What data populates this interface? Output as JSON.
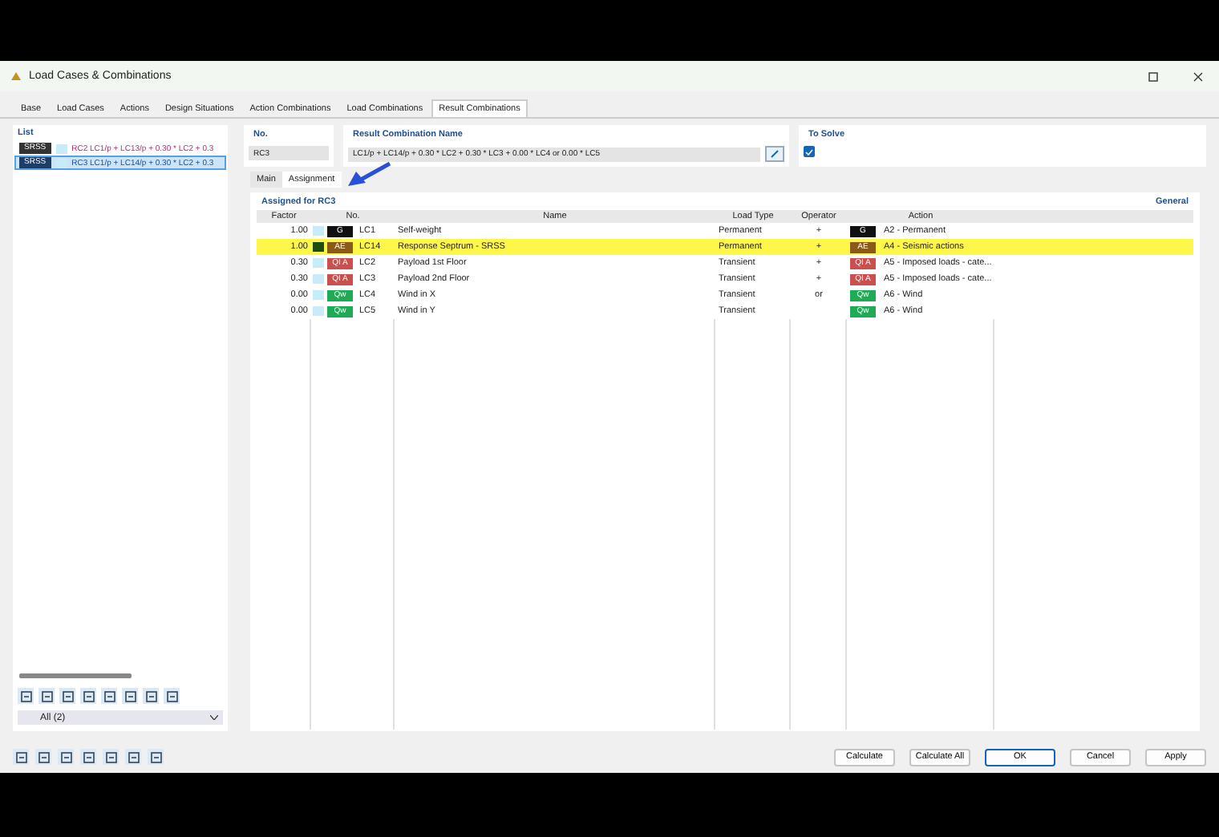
{
  "window": {
    "title": "Load Cases & Combinations"
  },
  "tabs": [
    {
      "label": "Base",
      "selected": false
    },
    {
      "label": "Load Cases",
      "selected": false
    },
    {
      "label": "Actions",
      "selected": false
    },
    {
      "label": "Design Situations",
      "selected": false
    },
    {
      "label": "Action Combinations",
      "selected": false
    },
    {
      "label": "Load Combinations",
      "selected": false
    },
    {
      "label": "Result Combinations",
      "selected": true
    }
  ],
  "list": {
    "title": "List",
    "items": [
      {
        "badge": "SRSS",
        "text": "RC2 LC1/p + LC13/p + 0.30 * LC2 + 0.3",
        "selected": false
      },
      {
        "badge": "SRSS",
        "text": "RC3 LC1/p + LC14/p + 0.30 * LC2 + 0.3",
        "selected": true
      }
    ],
    "filter": "All (2)"
  },
  "number": {
    "label": "No.",
    "value": "RC3"
  },
  "name": {
    "label": "Result Combination Name",
    "value": "LC1/p + LC14/p + 0.30 * LC2 + 0.30 * LC3 + 0.00 * LC4 or 0.00 * LC5"
  },
  "to_solve": {
    "label": "To Solve",
    "checked": true
  },
  "subtabs": [
    {
      "label": "Main",
      "selected": false
    },
    {
      "label": "Assignment",
      "selected": true
    }
  ],
  "table": {
    "title": "Assigned for RC3",
    "link": "General",
    "columns": [
      "Factor",
      "No.",
      "Name",
      "Load Type",
      "Operator",
      "Action"
    ],
    "rows": [
      {
        "factor": "1.00",
        "badge": "G",
        "color": "#111111",
        "lc": "LC1",
        "name": "Self-weight",
        "load_type": "Permanent",
        "operator": "+",
        "action_badge": "G",
        "action": "A2 - Permanent",
        "selected": false
      },
      {
        "factor": "1.00",
        "badge": "AE",
        "color": "#8b5a1b",
        "lc": "LC14",
        "name": "Response Septrum - SRSS",
        "load_type": "Permanent",
        "operator": "+",
        "action_badge": "AE",
        "action": "A4 - Seismic actions",
        "selected": true
      },
      {
        "factor": "0.30",
        "badge": "QI A",
        "color": "#c9504e",
        "lc": "LC2",
        "name": "Payload 1st Floor",
        "load_type": "Transient",
        "operator": "+",
        "action_badge": "QI A",
        "action": "A5 - Imposed loads - cate...",
        "selected": false
      },
      {
        "factor": "0.30",
        "badge": "QI A",
        "color": "#c9504e",
        "lc": "LC3",
        "name": "Payload 2nd Floor",
        "load_type": "Transient",
        "operator": "+",
        "action_badge": "QI A",
        "action": "A5 - Imposed loads - cate...",
        "selected": false
      },
      {
        "factor": "0.00",
        "badge": "Qw",
        "color": "#1faa55",
        "lc": "LC4",
        "name": "Wind in X",
        "load_type": "Transient",
        "operator": "or",
        "action_badge": "Qw",
        "action": "A6 - Wind",
        "selected": false
      },
      {
        "factor": "0.00",
        "badge": "Qw",
        "color": "#1faa55",
        "lc": "LC5",
        "name": "Wind in Y",
        "load_type": "Transient",
        "operator": "",
        "action_badge": "Qw",
        "action": "A6 - Wind",
        "selected": false
      }
    ]
  },
  "buttons": [
    {
      "label": "Calculate",
      "kind": "normal"
    },
    {
      "label": "Calculate All",
      "kind": "normal"
    },
    {
      "label": "OK",
      "kind": "default"
    },
    {
      "label": "Cancel",
      "kind": "normal"
    },
    {
      "label": "Apply",
      "kind": "normal"
    }
  ]
}
